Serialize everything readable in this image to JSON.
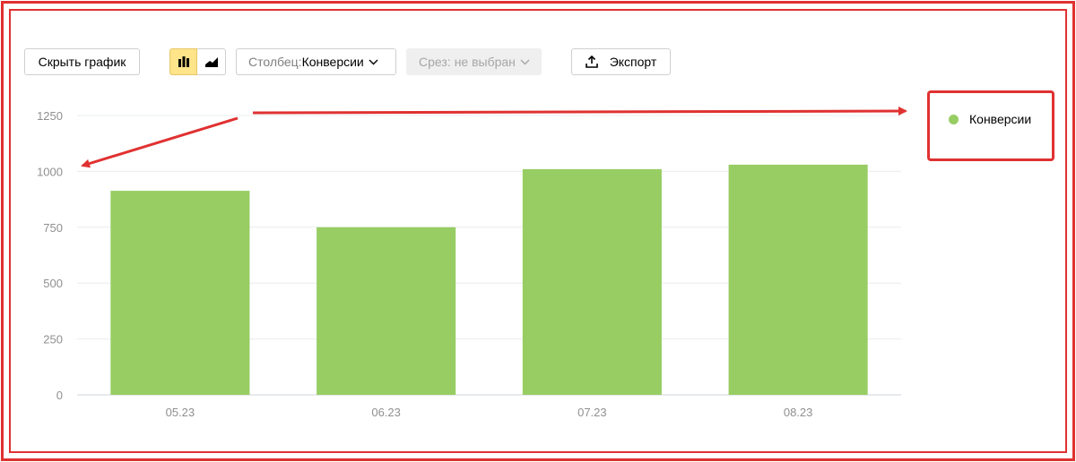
{
  "toolbar": {
    "hide_chart_label": "Скрыть график",
    "chart_type_bar_icon": "bar-chart-icon",
    "chart_type_area_icon": "area-chart-icon",
    "column_key": "Столбец:",
    "column_value": "Конверсии",
    "slice_key": "Срез:",
    "slice_value": "не выбран",
    "export_label": "Экспорт",
    "export_icon": "upload-icon"
  },
  "colors": {
    "bar": "#97cd63",
    "annotation": "#e03131",
    "active_toggle": "#ffe48a"
  },
  "chart_data": {
    "type": "bar",
    "categories": [
      "05.23",
      "06.23",
      "07.23",
      "08.23"
    ],
    "series": [
      {
        "name": "Конверсии",
        "values": [
          913,
          750,
          1010,
          1030
        ]
      }
    ],
    "yticks": [
      "0",
      "250",
      "500",
      "750",
      "1000",
      "1250"
    ],
    "ylim": [
      0,
      1250
    ],
    "grid": true,
    "legend_position": "right"
  },
  "legend": {
    "items": [
      {
        "label": "Конверсии"
      }
    ]
  }
}
